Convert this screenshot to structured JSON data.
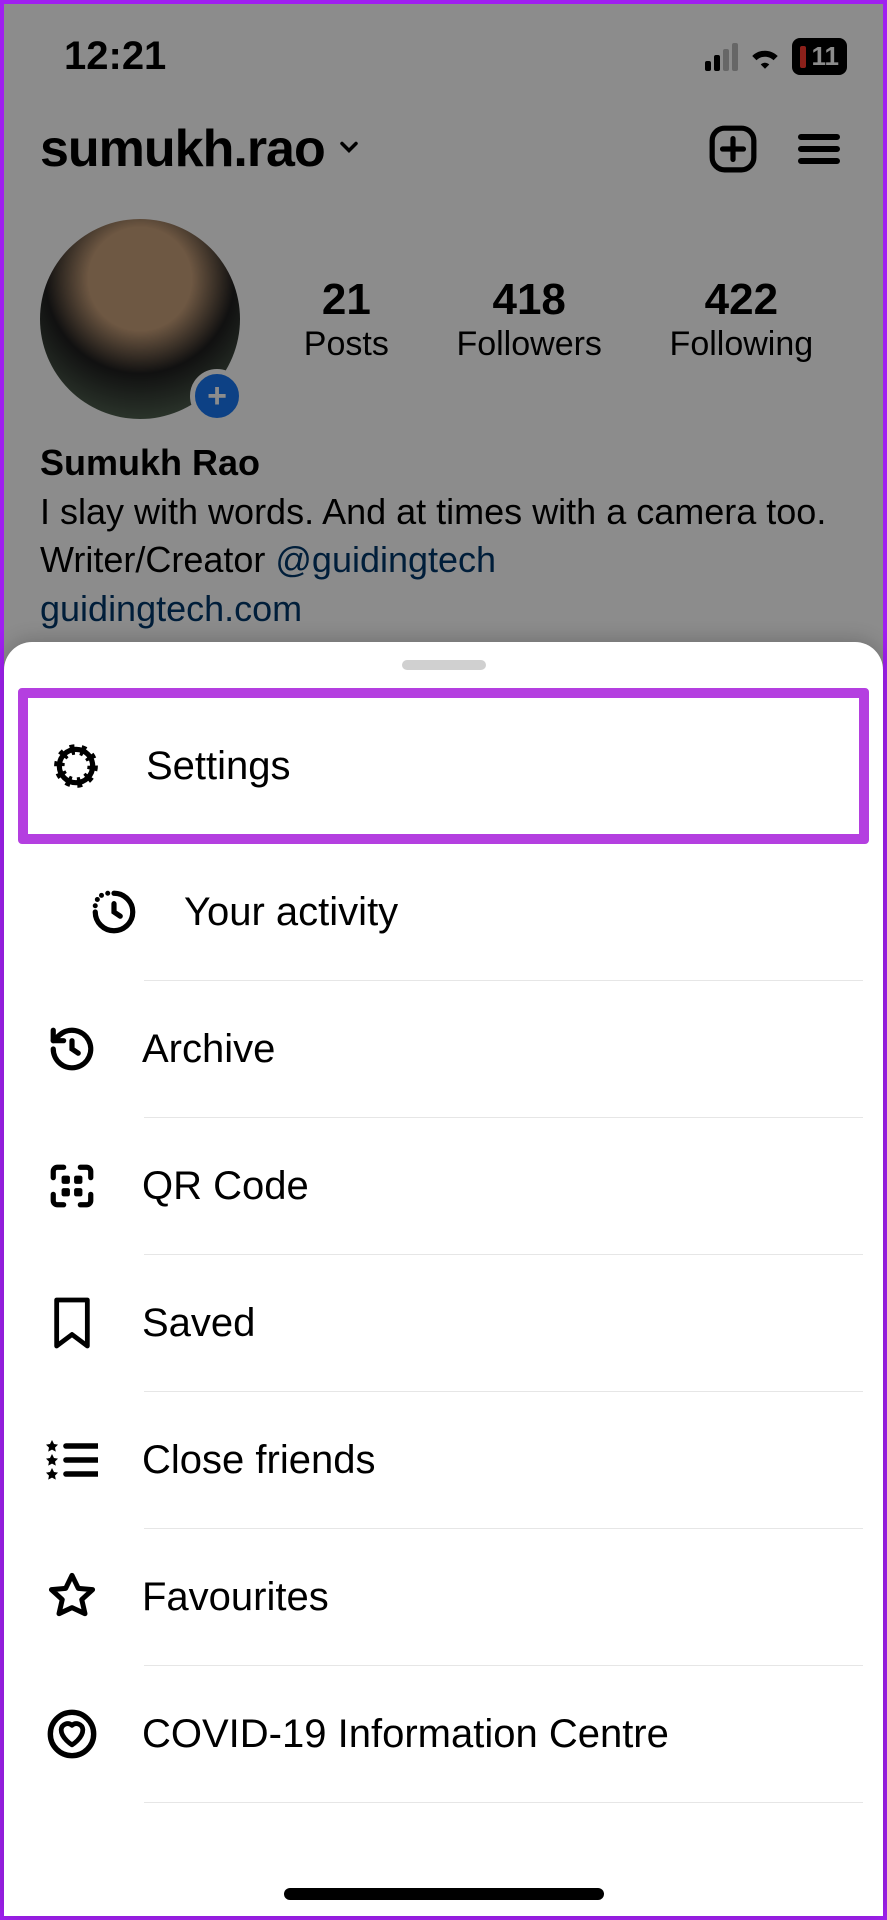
{
  "status_bar": {
    "time": "12:21",
    "battery_pct": "11"
  },
  "profile": {
    "username": "sumukh.rao",
    "display_name": "Sumukh Rao",
    "bio_line1": "I slay with words. And at times with a camera too.",
    "bio_line2_prefix": "Writer/Creator ",
    "mention": "@guidingtech",
    "link": "guidingtech.com",
    "stats": {
      "posts": {
        "count": "21",
        "label": "Posts"
      },
      "followers": {
        "count": "418",
        "label": "Followers"
      },
      "following": {
        "count": "422",
        "label": "Following"
      }
    }
  },
  "menu": {
    "items": [
      {
        "icon": "settings-icon",
        "label": "Settings"
      },
      {
        "icon": "activity-icon",
        "label": "Your activity"
      },
      {
        "icon": "archive-icon",
        "label": "Archive"
      },
      {
        "icon": "qr-code-icon",
        "label": "QR Code"
      },
      {
        "icon": "saved-icon",
        "label": "Saved"
      },
      {
        "icon": "close-friends-icon",
        "label": "Close friends"
      },
      {
        "icon": "favourites-icon",
        "label": "Favourites"
      },
      {
        "icon": "covid-info-icon",
        "label": "COVID-19 Information Centre"
      }
    ]
  }
}
